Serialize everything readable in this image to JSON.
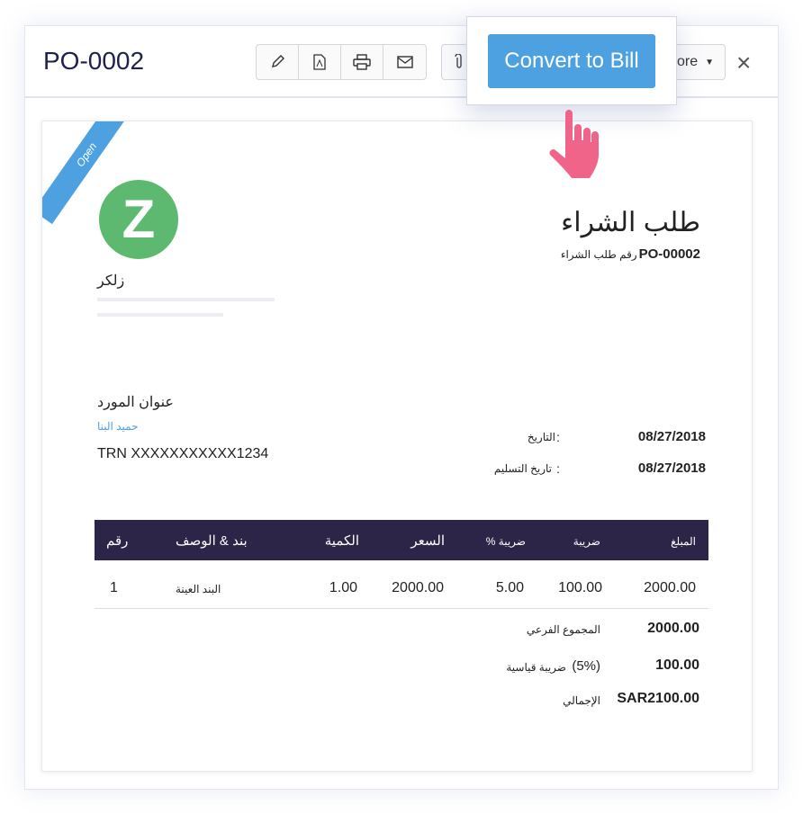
{
  "header": {
    "title": "PO-0002",
    "more_label": "More",
    "close": "×"
  },
  "toolbar": {
    "icons": [
      "pencil-icon",
      "pdf-icon",
      "printer-icon",
      "mail-icon"
    ],
    "attach_icon": "paperclip-icon"
  },
  "popup": {
    "convert_label": "Convert to Bill"
  },
  "document": {
    "status": "Open",
    "logo_letter": "Z",
    "company_name": "زلكر",
    "doc_title": "طلب الشراء",
    "po_label": "رقم طلب الشراء",
    "po_number": "PO-00002",
    "vendor_heading": "عنوان المورد",
    "vendor_name": "حميد البنا",
    "trn": "TRN XXXXXXXXXXX1234",
    "date_label": "التاريخ",
    "date_value": "08/27/2018",
    "delivery_label": "تاريخ التسليم",
    "delivery_value": "08/27/2018",
    "colon": ":"
  },
  "table": {
    "headers": [
      "رقم",
      "بند & الوصف",
      "الكمية",
      "السعر",
      "ضريبة %",
      "ضريبة",
      "المبلغ"
    ],
    "rows": [
      [
        "1",
        "البند العينة",
        "1.00",
        "2000.00",
        "5.00",
        "100.00",
        "2000.00"
      ]
    ]
  },
  "totals": {
    "subtotal_label": "المجموع الفرعي",
    "subtotal": "2000.00",
    "tax_label": "ضريبة قياسية",
    "tax_rate": "(5%)",
    "tax": "100.00",
    "total_label": "الإجمالي",
    "total": "SAR2100.00"
  },
  "colors": {
    "accent": "#4ea1e1",
    "table_header": "#2c2548",
    "logo": "#5cb96f",
    "cursor": "#f0648a"
  }
}
